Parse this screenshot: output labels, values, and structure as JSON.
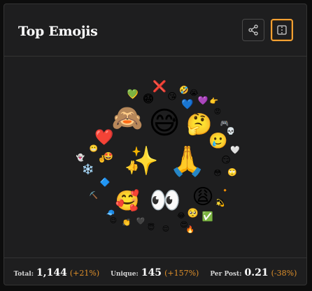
{
  "header": {
    "title": "Top Emojis"
  },
  "buttons": {
    "share_icon": "share-icon",
    "split_icon": "split-view-icon",
    "accent_color": "#f2a033"
  },
  "emojis": [
    {
      "char": "😅",
      "size": 44,
      "name": "emoji-sweat-smile"
    },
    {
      "char": "🙏",
      "size": 42,
      "name": "emoji-folded-hands"
    },
    {
      "char": "✨",
      "size": 40,
      "name": "emoji-sparkles"
    },
    {
      "char": "🙈",
      "size": 36,
      "name": "emoji-see-no-evil-monkey"
    },
    {
      "char": "👀",
      "size": 36,
      "name": "emoji-eyes"
    },
    {
      "char": "🥰",
      "size": 28,
      "name": "emoji-smiling-hearts"
    },
    {
      "char": "🤔",
      "size": 30,
      "name": "emoji-thinking-face"
    },
    {
      "char": "😩",
      "size": 30,
      "name": "emoji-weary-face"
    },
    {
      "char": "❤️",
      "size": 22,
      "name": "emoji-red-heart"
    },
    {
      "char": "🥲",
      "size": 22,
      "name": "emoji-smiling-tear"
    },
    {
      "char": "💙",
      "size": 14,
      "name": "emoji-blue-heart"
    },
    {
      "char": "😆",
      "size": 14,
      "name": "emoji-grinning-squinting"
    },
    {
      "char": "💛",
      "size": 13,
      "name": "emoji-yellow-heart"
    },
    {
      "char": "❌",
      "size": 16,
      "name": "emoji-cross-mark"
    },
    {
      "char": "💚",
      "size": 12,
      "name": "emoji-green-heart"
    },
    {
      "char": "😁",
      "size": 16,
      "name": "emoji-beaming-face"
    },
    {
      "char": "😘",
      "size": 13,
      "name": "emoji-face-blowing-kiss"
    },
    {
      "char": "🤣",
      "size": 11,
      "name": "emoji-rofl"
    },
    {
      "char": "😭",
      "size": 11,
      "name": "emoji-crying-face"
    },
    {
      "char": "💜",
      "size": 12,
      "name": "emoji-purple-heart"
    },
    {
      "char": "👉",
      "size": 10,
      "name": "emoji-pointing-right"
    },
    {
      "char": "😡",
      "size": 10,
      "name": "emoji-angry-face"
    },
    {
      "char": "🎮",
      "size": 10,
      "name": "emoji-game-controller"
    },
    {
      "char": "💀",
      "size": 10,
      "name": "emoji-skull"
    },
    {
      "char": "🤍",
      "size": 11,
      "name": "emoji-white-heart"
    },
    {
      "char": "😏",
      "size": 13,
      "name": "emoji-smirking-face"
    },
    {
      "char": "🙄",
      "size": 11,
      "name": "emoji-rolling-eyes"
    },
    {
      "char": "😳",
      "size": 11,
      "name": "emoji-flushed-face"
    },
    {
      "char": "🔸",
      "size": 10,
      "name": "emoji-orange-diamond"
    },
    {
      "char": "😮",
      "size": 10,
      "name": "emoji-open-mouth"
    },
    {
      "char": "🥺",
      "size": 13,
      "name": "emoji-pleading-face"
    },
    {
      "char": "✅",
      "size": 13,
      "name": "emoji-check-mark"
    },
    {
      "char": "💫",
      "size": 10,
      "name": "emoji-dizzy"
    },
    {
      "char": "😂",
      "size": 10,
      "name": "emoji-tears-of-joy"
    },
    {
      "char": "🔥",
      "size": 10,
      "name": "emoji-fire"
    },
    {
      "char": "😍",
      "size": 11,
      "name": "emoji-heart-eyes"
    },
    {
      "char": "😌",
      "size": 10,
      "name": "emoji-relieved-face"
    },
    {
      "char": "😇",
      "size": 10,
      "name": "emoji-halo-face"
    },
    {
      "char": "🖤",
      "size": 10,
      "name": "emoji-black-heart"
    },
    {
      "char": "👏",
      "size": 10,
      "name": "emoji-clapping"
    },
    {
      "char": "😉",
      "size": 10,
      "name": "emoji-winking"
    },
    {
      "char": "🧢",
      "size": 10,
      "name": "emoji-cap"
    },
    {
      "char": "⛏️",
      "size": 10,
      "name": "emoji-pick"
    },
    {
      "char": "🔷",
      "size": 12,
      "name": "emoji-blue-diamond"
    },
    {
      "char": "❄️",
      "size": 14,
      "name": "emoji-snowflake"
    },
    {
      "char": "👻",
      "size": 10,
      "name": "emoji-ghost"
    },
    {
      "char": "🤞",
      "size": 10,
      "name": "emoji-crossed-fingers"
    },
    {
      "char": "👍",
      "size": 14,
      "name": "emoji-thumbs-up"
    },
    {
      "char": "🤩",
      "size": 11,
      "name": "emoji-star-struck"
    },
    {
      "char": "😬",
      "size": 10,
      "name": "emoji-grimacing"
    }
  ],
  "footer": {
    "total_label": "Total:",
    "total_value": "1,144",
    "total_change": "(+21%)",
    "unique_label": "Unique:",
    "unique_value": "145",
    "unique_change": "(+157%)",
    "perpost_label": "Per Post:",
    "perpost_value": "0.21",
    "perpost_change": "(-38%)"
  }
}
